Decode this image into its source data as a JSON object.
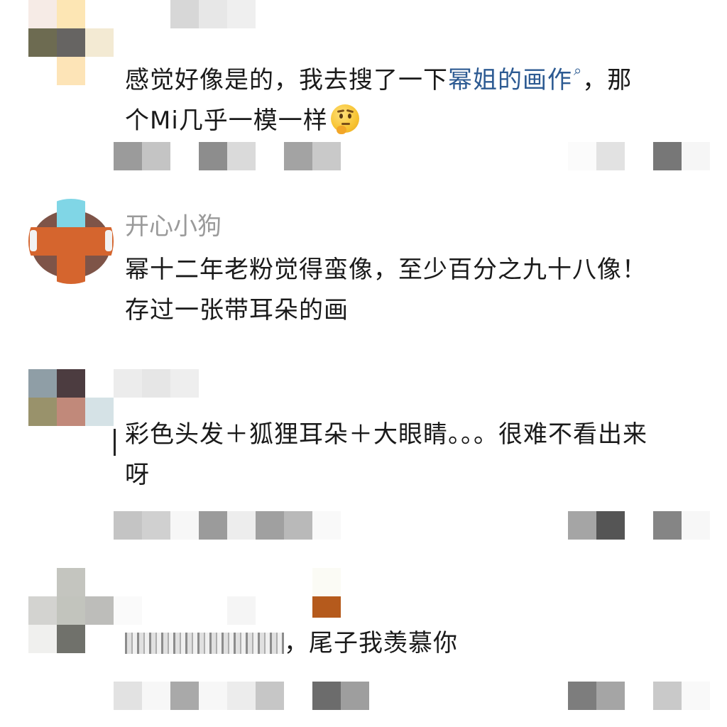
{
  "colors": {
    "text": "#1a1a1a",
    "username": "#9a9a9a",
    "link": "#2c5a92",
    "background": "#ffffff"
  },
  "comments": [
    {
      "id": "c1",
      "text_before_link": "感觉好像是的，我去搜了一下",
      "link_text": "幂姐的画作",
      "link_icon": "search-icon",
      "text_after_link": "，那",
      "line2": "个Mi几乎一模一样",
      "emoji": "thinking-face-emoji"
    },
    {
      "id": "c2",
      "username": "开心小狗",
      "line1": "幂十二年老粉觉得蛮像，至少百分之九十八像！",
      "line2": "存过一张带耳朵的画"
    },
    {
      "id": "c3",
      "line1": "彩色头发＋狐狸耳朵＋大眼睛。。。很难不看出来",
      "line2": "呀"
    },
    {
      "id": "c4",
      "text_after_blur": "，尾子我羡慕你"
    }
  ]
}
